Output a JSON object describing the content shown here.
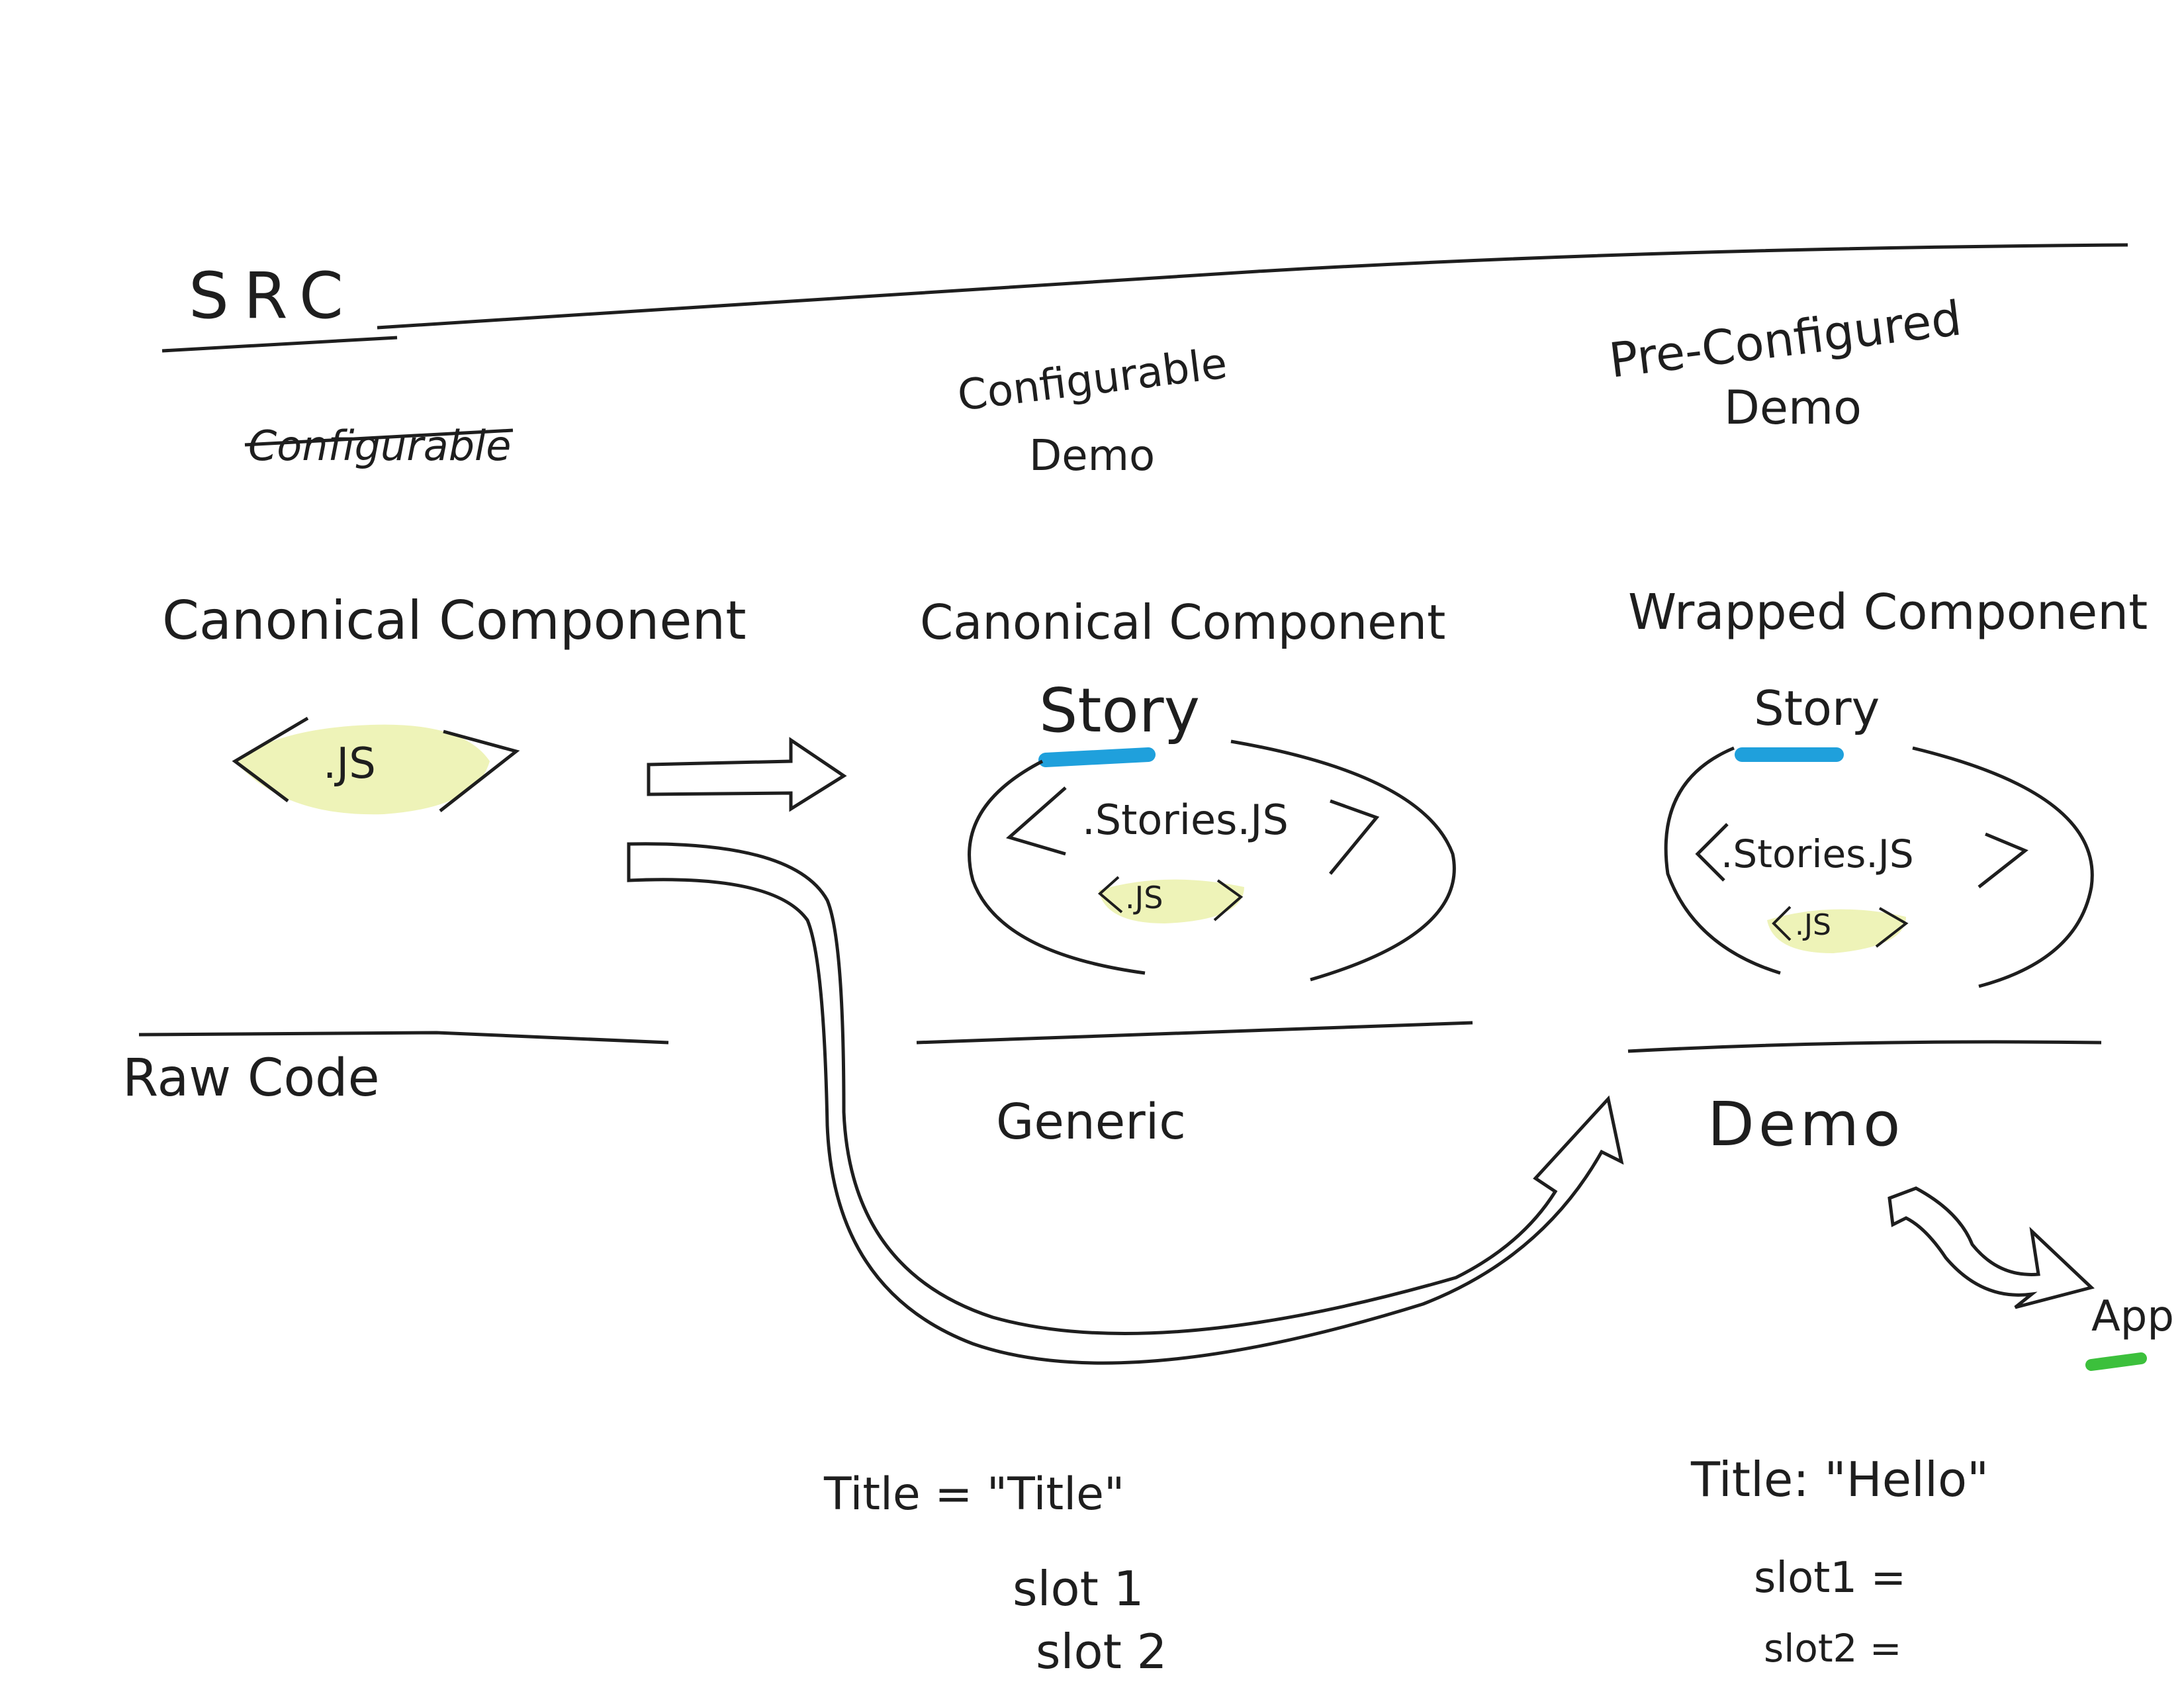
{
  "colors": {
    "ink": "#1e1e1e",
    "highlight_yellow": "#eef3b8",
    "highlight_blue": "#1fa0dc",
    "highlight_green": "#3cc03c"
  },
  "left": {
    "section": "SRC",
    "struck_word": "Configurable",
    "component_label": "Canonical Component",
    "file": ".JS",
    "bottom_label": "Raw Code"
  },
  "middle": {
    "header_line1": "Configurable",
    "header_line2": "Demo",
    "component_label": "Canonical Component",
    "story_label": "Story",
    "stories_file": ".Stories.JS",
    "inner_file": ".JS",
    "bottom_label": "Generic",
    "props": {
      "title": "Title = \"Title\"",
      "slot1": "slot 1",
      "slot2": "slot 2"
    }
  },
  "right": {
    "header_line1": "Pre-Configured",
    "header_line2": "Demo",
    "component_label": "Wrapped Component",
    "story_label": "Story",
    "stories_file": ".Stories.JS",
    "inner_file": ".JS",
    "bottom_label": "Demo",
    "props": {
      "title": "Title: \"Hello\"",
      "slot1": "slot1 =",
      "slot2": "slot2 ="
    }
  },
  "app_label": "App"
}
